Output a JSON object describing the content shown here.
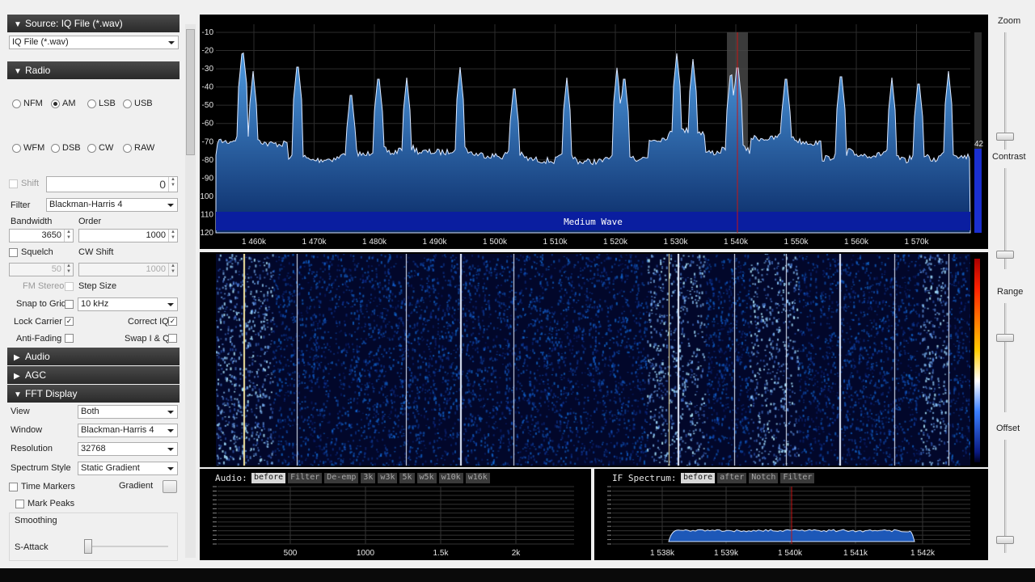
{
  "left_panel": {
    "source": {
      "header": "Source: IQ File (*.wav)",
      "selected": "IQ File (*.wav)"
    },
    "radio": {
      "header": "Radio",
      "modes_row1": [
        "NFM",
        "AM",
        "LSB",
        "USB"
      ],
      "modes_row2": [
        "WFM",
        "DSB",
        "CW",
        "RAW"
      ],
      "selected_mode": "AM",
      "shift_label": "Shift",
      "shift_value": "0",
      "filter_label": "Filter",
      "filter_value": "Blackman-Harris 4",
      "bandwidth_label": "Bandwidth",
      "bandwidth_value": "3650",
      "order_label": "Order",
      "order_value": "1000",
      "squelch_label": "Squelch",
      "squelch_value": "50",
      "cw_shift_label": "CW Shift",
      "cw_shift_value": "1000",
      "fm_stereo_label": "FM Stereo",
      "step_size_label": "Step Size",
      "snap_to_grid_label": "Snap to Grid",
      "step_size_value": "10 kHz",
      "lock_carrier_label": "Lock Carrier",
      "correct_iq_label": "Correct IQ",
      "anti_fading_label": "Anti-Fading",
      "swap_iq_label": "Swap I & Q"
    },
    "sections": {
      "audio": "Audio",
      "agc": "AGC",
      "fft_display": "FFT Display"
    },
    "fft": {
      "view_label": "View",
      "view_value": "Both",
      "window_label": "Window",
      "window_value": "Blackman-Harris 4",
      "resolution_label": "Resolution",
      "resolution_value": "32768",
      "spectrum_style_label": "Spectrum Style",
      "spectrum_style_value": "Static Gradient",
      "time_markers_label": "Time Markers",
      "gradient_label": "Gradient",
      "mark_peaks_label": "Mark Peaks",
      "smoothing_label": "Smoothing",
      "s_attack_label": "S-Attack"
    }
  },
  "spectrum": {
    "y_ticks": [
      "-10",
      "-20",
      "-30",
      "-40",
      "-50",
      "-60",
      "-70",
      "-80",
      "-90",
      "100",
      "110",
      "120"
    ],
    "x_ticks": [
      "1 460k",
      "1 470k",
      "1 480k",
      "1 490k",
      "1 500k",
      "1 510k",
      "1 520k",
      "1 530k",
      "1 540k",
      "1 550k",
      "1 560k",
      "1 570k"
    ],
    "band_label": "Medium Wave",
    "level_value": "42",
    "colors": {
      "fill_top": "#4d9ae0",
      "fill_bottom": "#0a2a66",
      "band": "#0a1ea0",
      "tuned_line": "#c81414"
    }
  },
  "audio_panel": {
    "title": "Audio:",
    "buttons": [
      "before",
      "Filter",
      "De-emp",
      "3k",
      "w3k",
      "5k",
      "w5k",
      "w10k",
      "w16k"
    ],
    "x_ticks": [
      "500",
      "1000",
      "1.5k",
      "2k"
    ]
  },
  "if_panel": {
    "title": "IF Spectrum:",
    "buttons": [
      "before",
      "after",
      "Notch",
      "Filter"
    ],
    "x_ticks": [
      "1 538k",
      "1 539k",
      "1 540k",
      "1 541k",
      "1 542k"
    ]
  },
  "right_panel": {
    "zoom_label": "Zoom",
    "contrast_label": "Contrast",
    "range_label": "Range",
    "offset_label": "Offset"
  }
}
